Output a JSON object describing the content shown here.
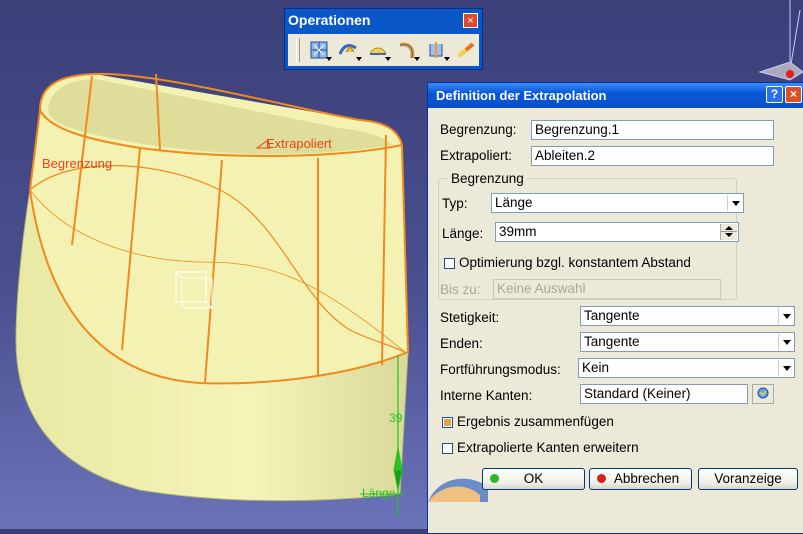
{
  "viewport": {
    "label_boundary": "Begrenzung",
    "label_extrapolated": "Extrapoliert",
    "label_length": "Länge",
    "dimension_value": "39",
    "colors": {
      "surface": "#f3f2b2",
      "edges": "#f08a1c",
      "manip": "#27c41f",
      "background": "#3f4482"
    }
  },
  "toolbar": {
    "title": "Operationen",
    "close_glyph": "×",
    "tools": [
      {
        "name": "join-icon"
      },
      {
        "name": "healing-icon"
      },
      {
        "name": "split-icon"
      },
      {
        "name": "trim-icon"
      },
      {
        "name": "boundary-icon"
      },
      {
        "name": "extrapolate-icon"
      }
    ]
  },
  "dialog": {
    "title": "Definition der Extrapolation",
    "help_glyph": "?",
    "close_glyph": "×",
    "boundary_label": "Begrenzung:",
    "boundary_value": "Begrenzung.1",
    "extrapolated_label": "Extrapoliert:",
    "extrapolated_value": "Ableiten.2",
    "group_title": "Begrenzung",
    "type_label": "Typ:",
    "type_value": "Länge",
    "length_label": "Länge:",
    "length_value": "39mm",
    "optimize_label": "Optimierung bzgl. konstantem Abstand",
    "optimize_checked": false,
    "until_label": "Bis zu:",
    "until_placeholder": "Keine Auswahl",
    "continuity_label": "Stetigkeit:",
    "continuity_value": "Tangente",
    "ends_label": "Enden:",
    "ends_value": "Tangente",
    "propagation_label": "Fortführungsmodus:",
    "propagation_value": "Kein",
    "internal_edges_label": "Interne Kanten:",
    "internal_edges_value": "Standard (Keiner)",
    "assemble_label": "Ergebnis zusammenfügen",
    "assemble_checked": true,
    "extend_edges_label": "Extrapolierte Kanten erweitern",
    "extend_edges_checked": false,
    "ok_label": "OK",
    "cancel_label": "Abbrechen",
    "preview_label": "Voranzeige",
    "colors": {
      "ok_dot": "#2bb52b",
      "cancel_dot": "#d42020"
    }
  }
}
